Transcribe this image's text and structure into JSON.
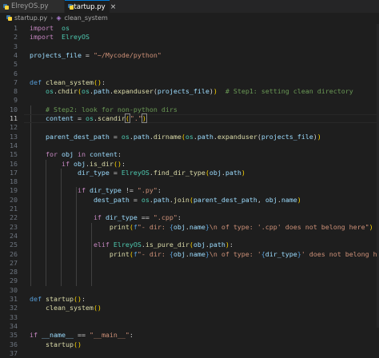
{
  "tabs": [
    {
      "name": "ElreyOS.py",
      "active": false
    },
    {
      "name": "startup.py",
      "active": true,
      "close": "×"
    }
  ],
  "breadcrumb": {
    "file": "startup.py",
    "symbol": "clean_system",
    "separator": "›"
  },
  "current_line": 11,
  "editor_lines": [
    {
      "n": "1",
      "t": [
        [
          "kw",
          "import"
        ],
        [
          "",
          "  "
        ],
        [
          "cl",
          "os"
        ]
      ]
    },
    {
      "n": "2",
      "t": [
        [
          "kw",
          "import"
        ],
        [
          "",
          "  "
        ],
        [
          "cl",
          "ElreyOS"
        ]
      ]
    },
    {
      "n": "3",
      "t": []
    },
    {
      "n": "4",
      "t": [
        [
          "v",
          "projects_file"
        ],
        [
          "",
          " = "
        ],
        [
          "s",
          "\"~/Mycode/python\""
        ]
      ]
    },
    {
      "n": "5",
      "t": []
    },
    {
      "n": "6",
      "t": []
    },
    {
      "n": "7",
      "t": [
        [
          "kd",
          "def"
        ],
        [
          "",
          " "
        ],
        [
          "fn",
          "clean_system"
        ],
        [
          "bc",
          "()"
        ],
        [
          ":",
          ":"
        ]
      ]
    },
    {
      "n": "8",
      "t": [
        [
          "",
          "    "
        ],
        [
          "cl",
          "os"
        ],
        [
          "",
          "."
        ],
        [
          "fn",
          "chdir"
        ],
        [
          "bc",
          "("
        ],
        [
          "cl",
          "os"
        ],
        [
          "",
          "."
        ],
        [
          "v",
          "path"
        ],
        [
          "",
          "."
        ],
        [
          "fn",
          "expanduser"
        ],
        [
          "",
          "("
        ],
        [
          "v",
          "projects_file"
        ],
        [
          "",
          ")"
        ],
        [
          "bc",
          ")"
        ],
        [
          "",
          "  "
        ],
        [
          "c",
          "# Step1: setting clean directory"
        ]
      ]
    },
    {
      "n": "9",
      "t": []
    },
    {
      "n": "10",
      "t": [
        [
          "",
          "    "
        ],
        [
          "c",
          "# Step2: look for non-python dirs"
        ]
      ]
    },
    {
      "n": "11",
      "t": [
        [
          "",
          "    "
        ],
        [
          "v",
          "content"
        ],
        [
          "",
          " = "
        ],
        [
          "cl",
          "os"
        ],
        [
          "",
          "."
        ],
        [
          "fn",
          "scandir"
        ],
        [
          "bcbr",
          "("
        ],
        [
          "s",
          "\".\""
        ],
        [
          "bcbr",
          ")"
        ]
      ]
    },
    {
      "n": "12",
      "t": []
    },
    {
      "n": "13",
      "t": [
        [
          "",
          "    "
        ],
        [
          "v",
          "parent_dest_path"
        ],
        [
          "",
          " = "
        ],
        [
          "cl",
          "os"
        ],
        [
          "",
          "."
        ],
        [
          "v",
          "path"
        ],
        [
          "",
          "."
        ],
        [
          "fn",
          "dirname"
        ],
        [
          "bc",
          "("
        ],
        [
          "cl",
          "os"
        ],
        [
          "",
          "."
        ],
        [
          "v",
          "path"
        ],
        [
          "",
          "."
        ],
        [
          "fn",
          "expanduser"
        ],
        [
          "",
          "("
        ],
        [
          "v",
          "projects_file"
        ],
        [
          "",
          ")"
        ],
        [
          "bc",
          ")"
        ]
      ]
    },
    {
      "n": "14",
      "t": []
    },
    {
      "n": "15",
      "t": [
        [
          "",
          "    "
        ],
        [
          "kw",
          "for"
        ],
        [
          "",
          " "
        ],
        [
          "v",
          "obj"
        ],
        [
          "",
          " "
        ],
        [
          "kw",
          "in"
        ],
        [
          "",
          " "
        ],
        [
          "v",
          "content"
        ],
        [
          "",
          ":"
        ]
      ]
    },
    {
      "n": "16",
      "t": [
        [
          "",
          "        "
        ],
        [
          "kw",
          "if"
        ],
        [
          "",
          " "
        ],
        [
          "v",
          "obj"
        ],
        [
          "",
          "."
        ],
        [
          "fn",
          "is_dir"
        ],
        [
          "bc",
          "()"
        ],
        [
          "",
          ":"
        ]
      ]
    },
    {
      "n": "17",
      "t": [
        [
          "",
          "            "
        ],
        [
          "v",
          "dir_type"
        ],
        [
          "",
          " = "
        ],
        [
          "cl",
          "ElreyOS"
        ],
        [
          "",
          "."
        ],
        [
          "fn",
          "find_dir_type"
        ],
        [
          "bc",
          "("
        ],
        [
          "v",
          "obj"
        ],
        [
          "",
          "."
        ],
        [
          "v",
          "path"
        ],
        [
          "bc",
          ")"
        ]
      ]
    },
    {
      "n": "18",
      "t": []
    },
    {
      "n": "19",
      "t": [
        [
          "",
          "            "
        ],
        [
          "kw",
          "if"
        ],
        [
          "",
          " "
        ],
        [
          "v",
          "dir_type"
        ],
        [
          "",
          " != "
        ],
        [
          "s",
          "\".py\""
        ],
        [
          "",
          ":"
        ]
      ]
    },
    {
      "n": "20",
      "t": [
        [
          "",
          "                "
        ],
        [
          "v",
          "dest_path"
        ],
        [
          "",
          " = "
        ],
        [
          "cl",
          "os"
        ],
        [
          "",
          "."
        ],
        [
          "v",
          "path"
        ],
        [
          "",
          "."
        ],
        [
          "fn",
          "join"
        ],
        [
          "bc",
          "("
        ],
        [
          "v",
          "parent_dest_path"
        ],
        [
          "",
          ", "
        ],
        [
          "v",
          "obj"
        ],
        [
          "",
          "."
        ],
        [
          "v",
          "name"
        ],
        [
          "bc",
          ")"
        ]
      ]
    },
    {
      "n": "21",
      "t": []
    },
    {
      "n": "22",
      "t": [
        [
          "",
          "                "
        ],
        [
          "kw",
          "if"
        ],
        [
          "",
          " "
        ],
        [
          "v",
          "dir_type"
        ],
        [
          "",
          " == "
        ],
        [
          "s",
          "\".cpp\""
        ],
        [
          "",
          ":"
        ]
      ]
    },
    {
      "n": "23",
      "t": [
        [
          "",
          "                    "
        ],
        [
          "fn",
          "print"
        ],
        [
          "bc",
          "("
        ],
        [
          "kd",
          "f"
        ],
        [
          "s",
          "\"- dir: "
        ],
        [
          "kd",
          "{"
        ],
        [
          "v",
          "obj"
        ],
        [
          "",
          "."
        ],
        [
          "v",
          "name"
        ],
        [
          "kd",
          "}"
        ],
        [
          "s",
          "\\n of type: '.cpp' does not belong here\""
        ],
        [
          "bc",
          ")"
        ]
      ]
    },
    {
      "n": "24",
      "t": []
    },
    {
      "n": "25",
      "t": [
        [
          "",
          "                "
        ],
        [
          "kw",
          "elif"
        ],
        [
          "",
          " "
        ],
        [
          "cl",
          "ElreyOS"
        ],
        [
          "",
          "."
        ],
        [
          "fn",
          "is_pure_dir"
        ],
        [
          "bc",
          "("
        ],
        [
          "v",
          "obj"
        ],
        [
          "",
          "."
        ],
        [
          "v",
          "path"
        ],
        [
          "bc",
          ")"
        ],
        [
          "",
          ":"
        ]
      ]
    },
    {
      "n": "26",
      "t": [
        [
          "",
          "                    "
        ],
        [
          "fn",
          "print"
        ],
        [
          "bc",
          "("
        ],
        [
          "kd",
          "f"
        ],
        [
          "s",
          "\"- dir: "
        ],
        [
          "kd",
          "{"
        ],
        [
          "v",
          "obj"
        ],
        [
          "",
          "."
        ],
        [
          "v",
          "name"
        ],
        [
          "kd",
          "}"
        ],
        [
          "s",
          "\\n of type: '"
        ],
        [
          "kd",
          "{"
        ],
        [
          "v",
          "dir_type"
        ],
        [
          "kd",
          "}"
        ],
        [
          "s",
          "' does not belong here\""
        ],
        [
          "bc",
          ")"
        ]
      ]
    },
    {
      "n": "27",
      "t": []
    },
    {
      "n": "28",
      "t": []
    },
    {
      "n": "29",
      "t": []
    },
    {
      "n": "30",
      "t": []
    },
    {
      "n": "31",
      "t": [
        [
          "kd",
          "def"
        ],
        [
          "",
          " "
        ],
        [
          "fn",
          "startup"
        ],
        [
          "bc",
          "()"
        ],
        [
          "",
          ":"
        ]
      ]
    },
    {
      "n": "32",
      "t": [
        [
          "",
          "    "
        ],
        [
          "fn",
          "clean_system"
        ],
        [
          "bc",
          "()"
        ]
      ]
    },
    {
      "n": "33",
      "t": []
    },
    {
      "n": "34",
      "t": []
    },
    {
      "n": "35",
      "t": [
        [
          "kw",
          "if"
        ],
        [
          "",
          " "
        ],
        [
          "v",
          "__name__"
        ],
        [
          "",
          " == "
        ],
        [
          "s",
          "\"__main__\""
        ],
        [
          "",
          ":"
        ]
      ]
    },
    {
      "n": "36",
      "t": [
        [
          "",
          "    "
        ],
        [
          "fn",
          "startup"
        ],
        [
          "bc",
          "()"
        ]
      ]
    },
    {
      "n": "37",
      "t": []
    }
  ],
  "colors": {
    "background": "#1e1e1e",
    "keyword": "#c586c0",
    "function": "#dcdcaa",
    "string": "#ce9178",
    "comment": "#6a9955",
    "variable": "#9cdcfe",
    "accent": "#0078d4"
  },
  "icons": [
    "python-file-icon",
    "symbol-method-icon",
    "close-icon"
  ]
}
